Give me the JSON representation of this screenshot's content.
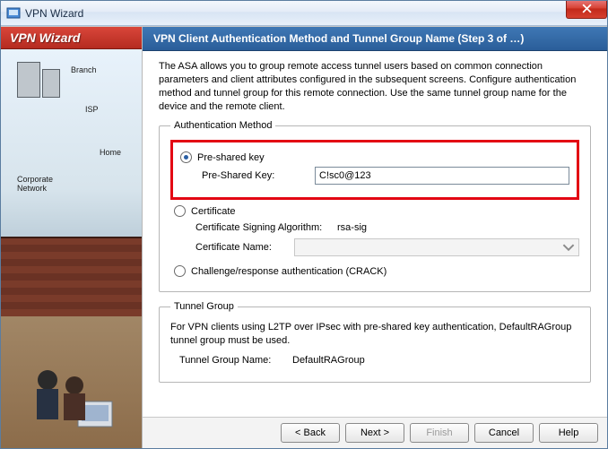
{
  "window": {
    "title": "VPN Wizard"
  },
  "sidebar": {
    "header": "VPN Wizard",
    "labels": {
      "branch": "Branch",
      "isp": "ISP",
      "home": "Home",
      "corp": "Corporate\nNetwork"
    }
  },
  "step": {
    "title": "VPN Client Authentication Method and Tunnel Group Name  (Step 3 of …)"
  },
  "intro": "The ASA allows you to group remote access tunnel users based on common connection parameters and client attributes configured in the subsequent screens. Configure authentication method and tunnel group for this remote connection. Use the same tunnel group name for the device and the remote client.",
  "auth": {
    "legend": "Authentication Method",
    "psk_radio": "Pre-shared key",
    "psk_label": "Pre-Shared Key:",
    "psk_value": "C!sc0@123",
    "cert_radio": "Certificate",
    "cert_algo_label": "Certificate Signing Algorithm:",
    "cert_algo_value": "rsa-sig",
    "cert_name_label": "Certificate Name:",
    "cert_name_value": "",
    "crack_radio": "Challenge/response authentication (CRACK)",
    "selected": "psk"
  },
  "tunnel": {
    "legend": "Tunnel Group",
    "note": "For VPN clients using L2TP over IPsec with pre-shared key authentication, DefaultRAGroup tunnel group must be used.",
    "name_label": "Tunnel Group Name:",
    "name_value": "DefaultRAGroup"
  },
  "buttons": {
    "back": "< Back",
    "next": "Next >",
    "finish": "Finish",
    "cancel": "Cancel",
    "help": "Help"
  }
}
